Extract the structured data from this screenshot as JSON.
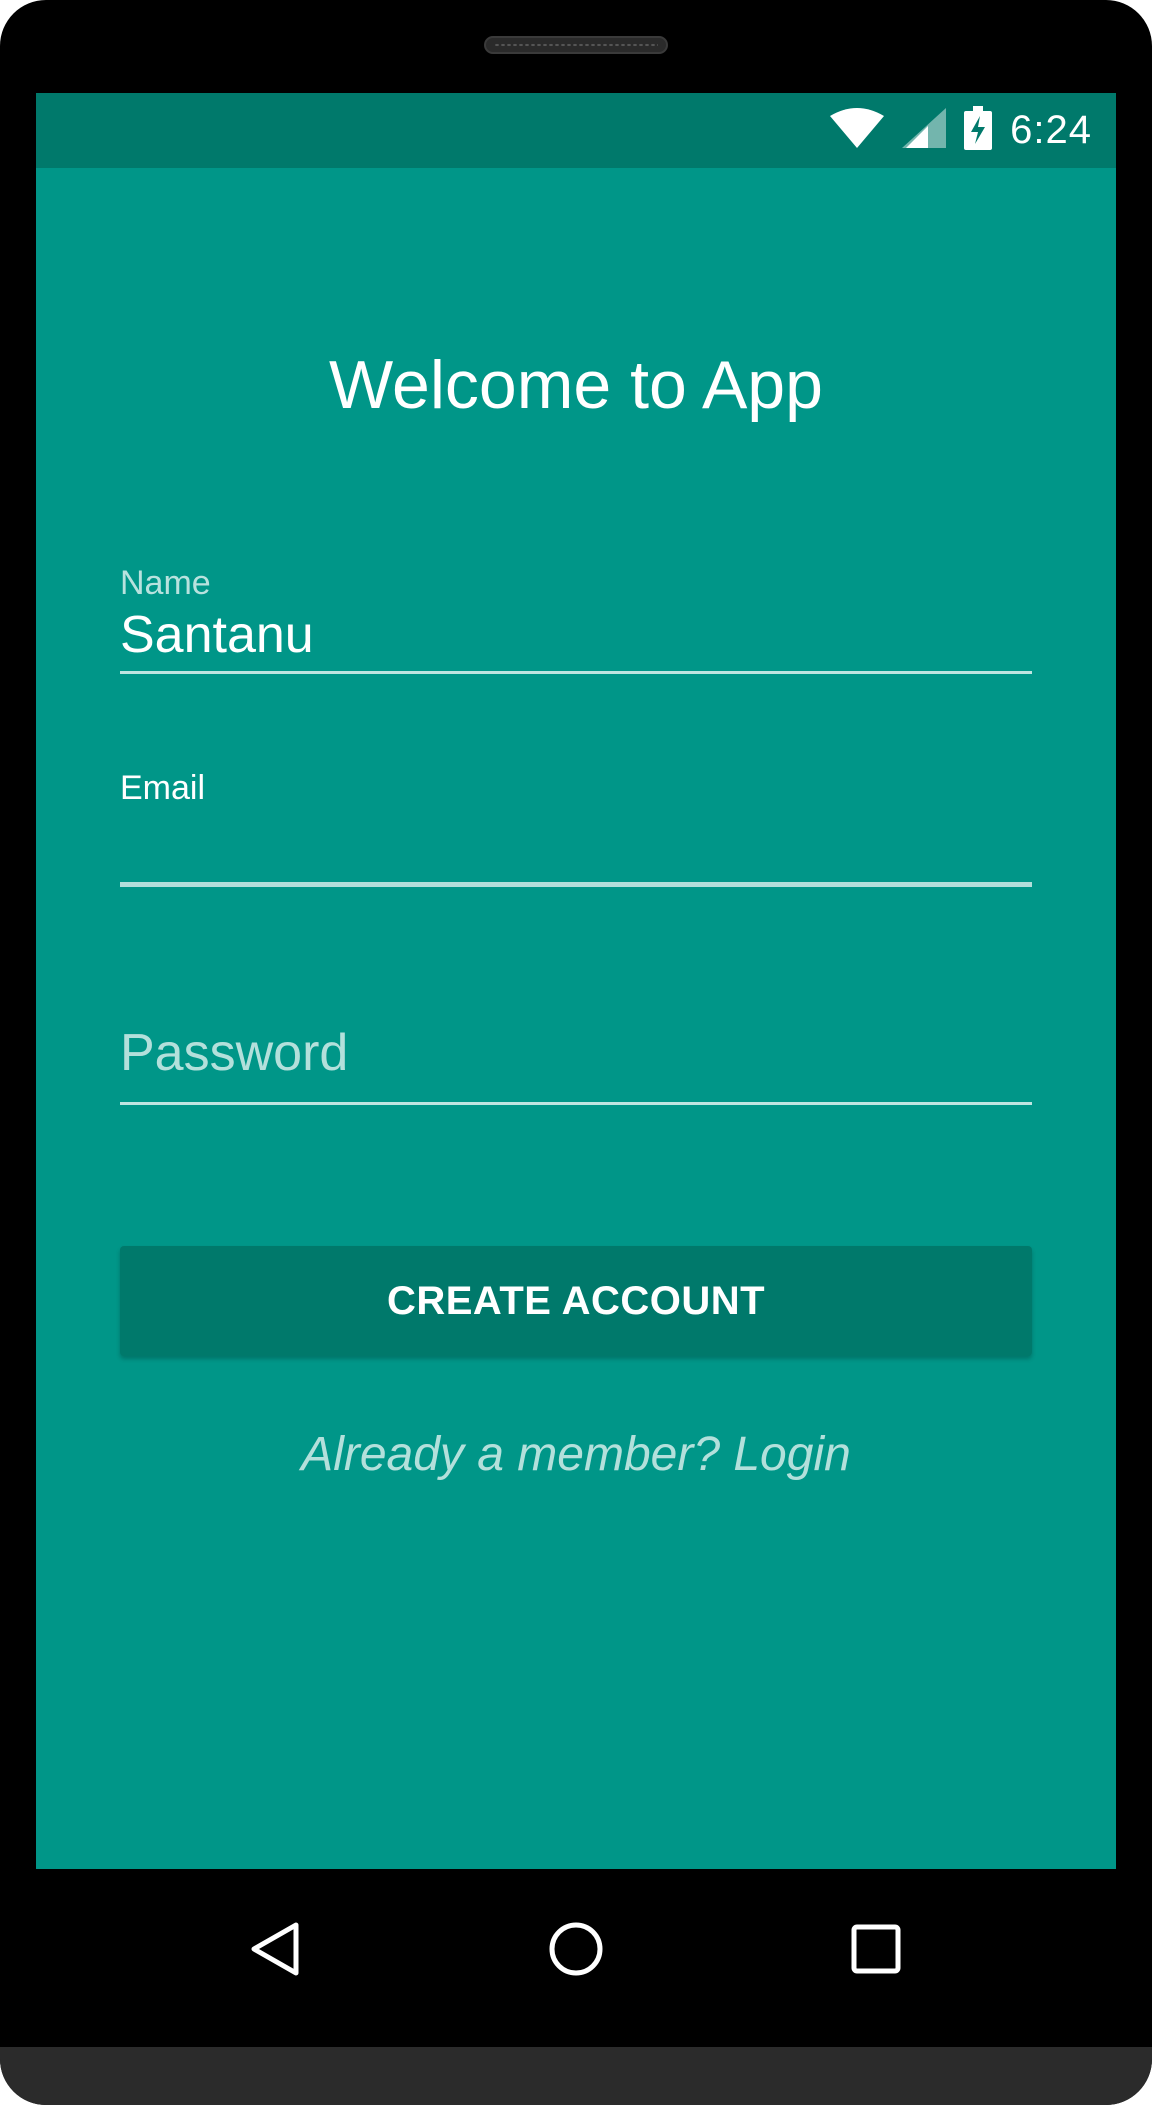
{
  "status_bar": {
    "time": "6:24",
    "icons": [
      "wifi-icon",
      "cell-signal-icon",
      "battery-charging-icon"
    ]
  },
  "screen": {
    "title": "Welcome to App",
    "background_color": "#009688",
    "status_bar_color": "#00796b",
    "accent_color": "#b2dfdb"
  },
  "form": {
    "name": {
      "label": "Name",
      "value": "Santanu"
    },
    "email": {
      "label": "Email",
      "value": ""
    },
    "password": {
      "placeholder": "Password",
      "value": ""
    },
    "submit_label": "CREATE ACCOUNT",
    "login_link": "Already a member? Login"
  },
  "navigation": {
    "buttons": [
      "back-icon",
      "home-icon",
      "recents-icon"
    ]
  }
}
